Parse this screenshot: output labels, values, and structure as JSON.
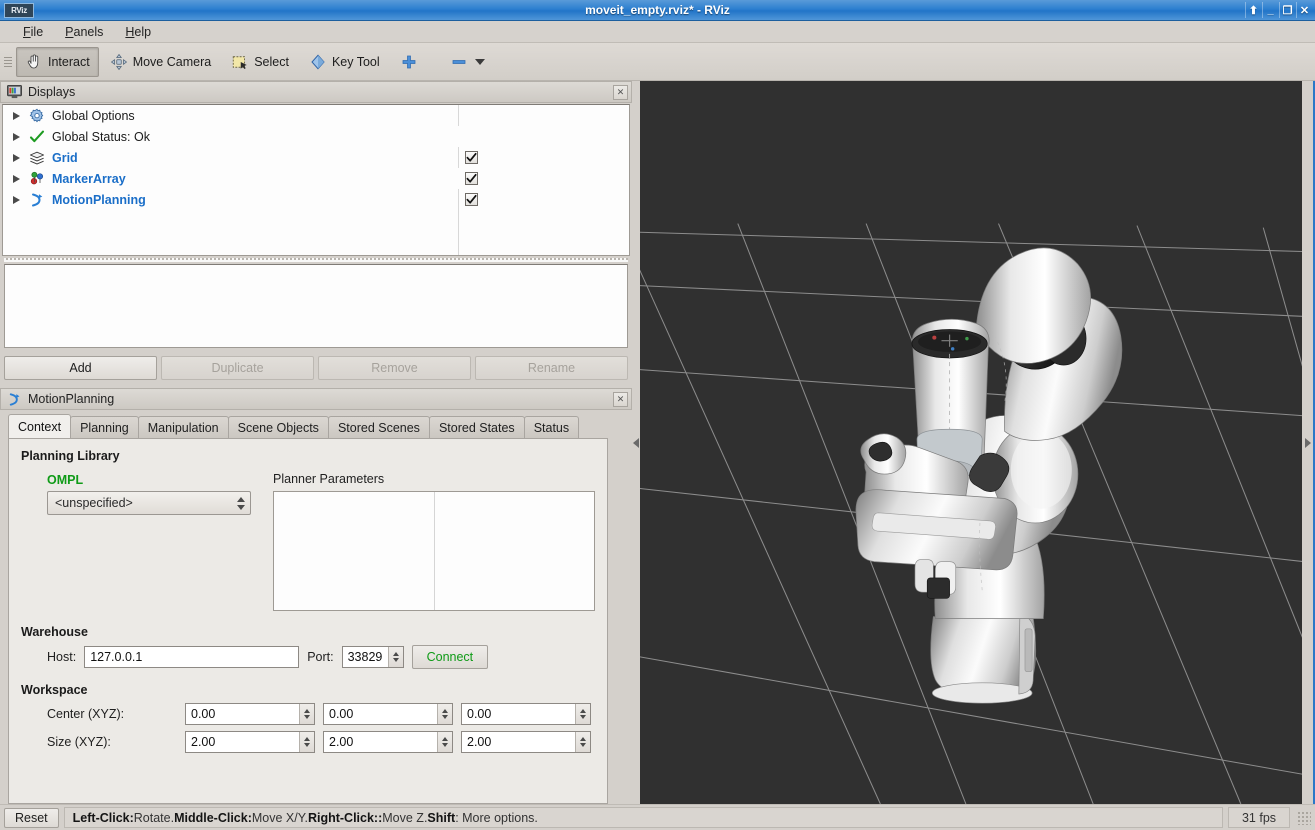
{
  "window": {
    "icon_label": "RViz",
    "title": "moveit_empty.rviz* - RViz",
    "controls": [
      {
        "name": "shade-button",
        "glyph": "⬆"
      },
      {
        "name": "minimize-button",
        "glyph": "_"
      },
      {
        "name": "maximize-button",
        "glyph": "❐"
      },
      {
        "name": "close-button",
        "glyph": "✕"
      }
    ]
  },
  "menubar": {
    "items": [
      {
        "mnemonic": "F",
        "rest": "ile"
      },
      {
        "mnemonic": "P",
        "rest": "anels"
      },
      {
        "mnemonic": "H",
        "rest": "elp"
      }
    ]
  },
  "toolbar": {
    "interact": "Interact",
    "move_camera": "Move Camera",
    "select": "Select",
    "key_tool": "Key Tool",
    "add_tool_icon": "plus-icon",
    "remove_tool_icon": "minus-icon"
  },
  "displays_panel": {
    "title": "Displays",
    "close_label": "✕",
    "rows": [
      {
        "label": "Global Options",
        "icon": "gear-icon",
        "link": false,
        "checkbox": null
      },
      {
        "label": "Global Status: Ok",
        "icon": "check-icon",
        "link": false,
        "checkbox": null
      },
      {
        "label": "Grid",
        "icon": "grid-icon",
        "link": true,
        "checkbox": true
      },
      {
        "label": "MarkerArray",
        "icon": "markers-icon",
        "link": true,
        "checkbox": true
      },
      {
        "label": "MotionPlanning",
        "icon": "motion-planning-icon",
        "link": true,
        "checkbox": true
      }
    ],
    "buttons": [
      {
        "label": "Add",
        "enabled": true
      },
      {
        "label": "Duplicate",
        "enabled": false
      },
      {
        "label": "Remove",
        "enabled": false
      },
      {
        "label": "Rename",
        "enabled": false
      }
    ]
  },
  "motion_planning_panel": {
    "title": "MotionPlanning",
    "close_label": "✕",
    "tabs": [
      {
        "label": "Context",
        "active": true
      },
      {
        "label": "Planning",
        "active": false
      },
      {
        "label": "Manipulation",
        "active": false
      },
      {
        "label": "Scene Objects",
        "active": false
      },
      {
        "label": "Stored Scenes",
        "active": false
      },
      {
        "label": "Stored States",
        "active": false
      },
      {
        "label": "Status",
        "active": false
      }
    ],
    "context": {
      "planning_library_title": "Planning Library",
      "library_name": "OMPL",
      "library_color": "#0f9b17",
      "planner_select_value": "<unspecified>",
      "planner_parameters_label": "Planner Parameters",
      "warehouse_title": "Warehouse",
      "host_label": "Host:",
      "host_value": "127.0.0.1",
      "port_label": "Port:",
      "port_value": "33829",
      "connect_label": "Connect",
      "workspace_title": "Workspace",
      "center_label": "Center (XYZ):",
      "center_values": [
        "0.00",
        "0.00",
        "0.00"
      ],
      "size_label": "Size (XYZ):",
      "size_values": [
        "2.00",
        "2.00",
        "2.00"
      ]
    }
  },
  "viewport": {
    "background_color": "#303030",
    "grid_color": "#9a9a9a",
    "robot_name": "panda-robot-arm"
  },
  "statusbar": {
    "reset_label": "Reset",
    "hint_left_key": "Left-Click:",
    "hint_left_val": " Rotate. ",
    "hint_mid_key": "Middle-Click:",
    "hint_mid_val": " Move X/Y. ",
    "hint_right_key": "Right-Click::",
    "hint_right_val": " Move Z. ",
    "hint_shift_key": "Shift",
    "hint_shift_val": ": More options.",
    "fps": "31 fps"
  }
}
